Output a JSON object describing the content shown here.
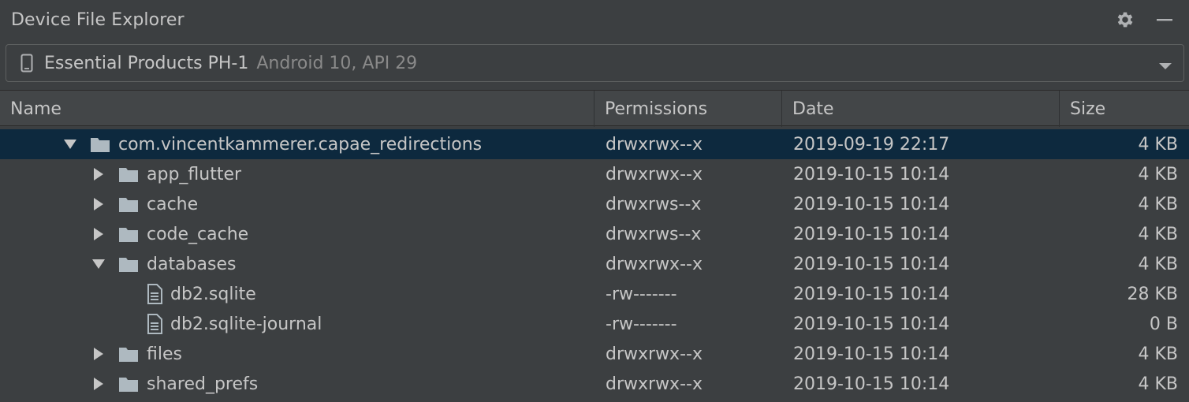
{
  "panel": {
    "title": "Device File Explorer"
  },
  "device": {
    "name": "Essential Products PH-1",
    "version": "Android 10, API 29"
  },
  "columns": {
    "name": "Name",
    "permissions": "Permissions",
    "date": "Date",
    "size": "Size"
  },
  "rows": [
    {
      "name": "com.vincentkammerer.capae_redirections",
      "perm": "drwxrwx--x",
      "date": "2019-09-19 22:17",
      "size": "4 KB"
    },
    {
      "name": "app_flutter",
      "perm": "drwxrwx--x",
      "date": "2019-10-15 10:14",
      "size": "4 KB"
    },
    {
      "name": "cache",
      "perm": "drwxrws--x",
      "date": "2019-10-15 10:14",
      "size": "4 KB"
    },
    {
      "name": "code_cache",
      "perm": "drwxrws--x",
      "date": "2019-10-15 10:14",
      "size": "4 KB"
    },
    {
      "name": "databases",
      "perm": "drwxrwx--x",
      "date": "2019-10-15 10:14",
      "size": "4 KB"
    },
    {
      "name": "db2.sqlite",
      "perm": "-rw-------",
      "date": "2019-10-15 10:14",
      "size": "28 KB"
    },
    {
      "name": "db2.sqlite-journal",
      "perm": "-rw-------",
      "date": "2019-10-15 10:14",
      "size": "0 B"
    },
    {
      "name": "files",
      "perm": "drwxrwx--x",
      "date": "2019-10-15 10:14",
      "size": "4 KB"
    },
    {
      "name": "shared_prefs",
      "perm": "drwxrwx--x",
      "date": "2019-10-15 10:14",
      "size": "4 KB"
    }
  ],
  "colors": {
    "background": "#3c3f41",
    "header": "#434648",
    "selection": "#0d293e",
    "text": "#c6c6c6",
    "muted": "#8a8a8a",
    "folder": "#aeb9c0"
  },
  "icons": {
    "settings": "gear-icon",
    "minimize": "minimize-icon",
    "device": "phone-icon",
    "dropdown": "chevron-down-icon",
    "folder": "folder-icon",
    "file": "file-icon"
  }
}
